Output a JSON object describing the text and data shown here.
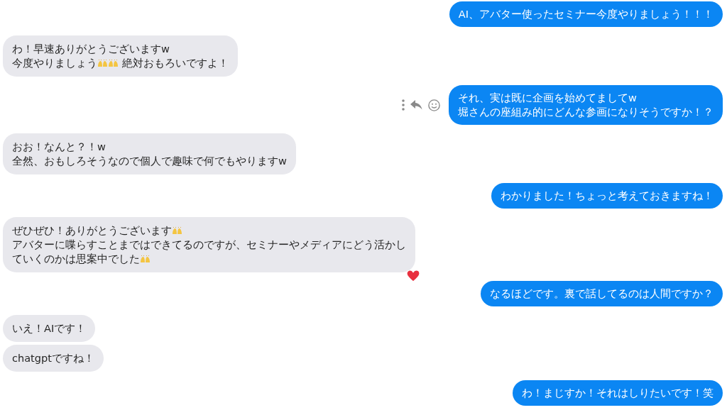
{
  "messages": [
    {
      "outgoing": true,
      "lines": [
        [
          {
            "kind": "text",
            "text": "AI、アバター使ったセミナー今度やりましょう！！！"
          }
        ]
      ]
    },
    {
      "outgoing": false,
      "lines": [
        [
          {
            "kind": "text",
            "text": "わ！早速ありがとうございますw"
          }
        ],
        [
          {
            "kind": "text",
            "text": "今度やりましょう"
          },
          {
            "kind": "emoji"
          },
          {
            "kind": "emoji"
          },
          {
            "kind": "text",
            "text": " 絶対おもろいですよ！"
          }
        ]
      ]
    },
    {
      "outgoing": true,
      "show_actions": true,
      "lines": [
        [
          {
            "kind": "text",
            "text": "それ、実は既に企画を始めてましてw"
          }
        ],
        [
          {
            "kind": "text",
            "text": "堀さんの座組み的にどんな参画になりそうですか！？"
          }
        ]
      ]
    },
    {
      "outgoing": false,
      "lines": [
        [
          {
            "kind": "text",
            "text": "おお！なんと？！w"
          }
        ],
        [
          {
            "kind": "text",
            "text": "全然、おもしろそうなので個人で趣味で何でもやりますw"
          }
        ]
      ]
    },
    {
      "outgoing": true,
      "lines": [
        [
          {
            "kind": "text",
            "text": "わかりました！ちょっと考えておきますね！"
          }
        ]
      ]
    },
    {
      "outgoing": false,
      "heart_reaction": true,
      "lines": [
        [
          {
            "kind": "text",
            "text": "ぜひぜひ！ありがとうございます"
          },
          {
            "kind": "emoji"
          }
        ],
        [
          {
            "kind": "text",
            "text": "アバターに喋らすことまではできてるのですが、セミナーやメディアにどう活かし"
          }
        ],
        [
          {
            "kind": "text",
            "text": "ていくのかは思案中でした"
          },
          {
            "kind": "emoji"
          }
        ]
      ]
    },
    {
      "outgoing": true,
      "lines": [
        [
          {
            "kind": "text",
            "text": "なるほどです。裏で話してるのは人間ですか？"
          }
        ]
      ]
    },
    {
      "outgoing": false,
      "lines": [
        [
          {
            "kind": "text",
            "text": "いえ！AIです！"
          }
        ]
      ]
    },
    {
      "outgoing": false,
      "lines": [
        [
          {
            "kind": "text",
            "text": "chatgptですね！"
          }
        ]
      ]
    },
    {
      "outgoing": true,
      "lines": [
        [
          {
            "kind": "text",
            "text": "わ！まじすか！それはしりたいです！笑"
          }
        ]
      ]
    }
  ]
}
